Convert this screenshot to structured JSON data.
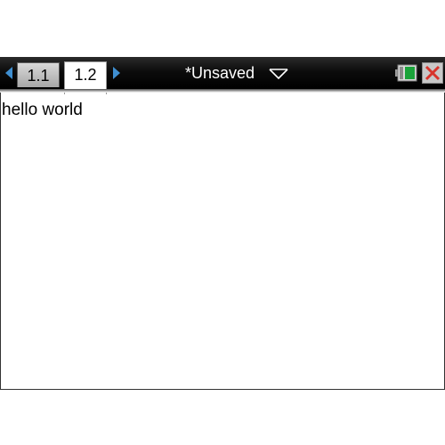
{
  "tabs": [
    {
      "label": "1.1",
      "active": false
    },
    {
      "label": "1.2",
      "active": true
    }
  ],
  "document": {
    "title": "*Unsaved"
  },
  "status": {
    "battery_icon": "battery-icon",
    "close_icon": "close-icon",
    "battery_color": "#1aa33a",
    "close_color": "#d8342c",
    "accent_color": "#3f8fd1"
  },
  "content": {
    "text": "hello world"
  }
}
